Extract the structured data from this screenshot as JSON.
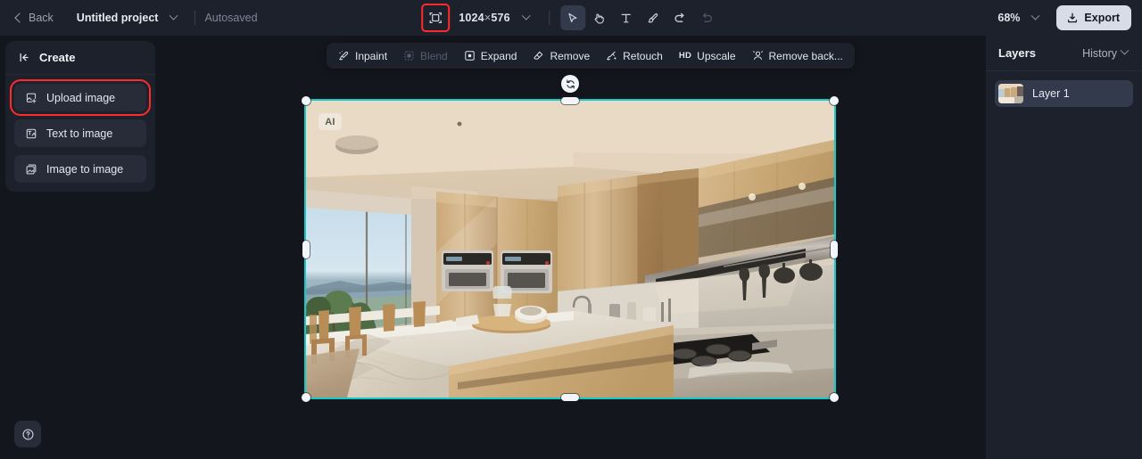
{
  "topbar": {
    "back_label": "Back",
    "project_name": "Untitled project",
    "autosaved_label": "Autosaved",
    "canvas_size_label": "1024 × 576",
    "canvas_width": "1024",
    "canvas_multiply": "×",
    "canvas_height": "576",
    "zoom_level": "68%",
    "export_label": "Export",
    "tools": [
      {
        "name": "crop-resize-icon",
        "label": "Resize canvas",
        "state": "highlighted"
      },
      {
        "name": "select-tool",
        "label": "Select",
        "state": "active"
      },
      {
        "name": "hand-tool",
        "label": "Pan",
        "state": "normal"
      },
      {
        "name": "text-tool",
        "label": "Text",
        "state": "normal"
      },
      {
        "name": "brush-tool",
        "label": "Brush",
        "state": "normal"
      },
      {
        "name": "undo-button",
        "label": "Undo",
        "state": "normal"
      },
      {
        "name": "redo-button",
        "label": "Redo",
        "state": "disabled"
      }
    ]
  },
  "left_panel": {
    "title": "Create",
    "collapse_icon": "collapse-left-icon",
    "items": [
      {
        "label": "Upload image",
        "icon": "upload-image-icon",
        "highlighted": true
      },
      {
        "label": "Text to image",
        "icon": "text-to-image-icon",
        "highlighted": false
      },
      {
        "label": "Image to image",
        "icon": "image-to-image-icon",
        "highlighted": false
      }
    ]
  },
  "edit_toolbar": {
    "items": [
      {
        "label": "Inpaint",
        "icon": "inpaint-icon",
        "disabled": false
      },
      {
        "label": "Blend",
        "icon": "blend-icon",
        "disabled": true
      },
      {
        "label": "Expand",
        "icon": "expand-icon",
        "disabled": false
      },
      {
        "label": "Remove",
        "icon": "remove-icon",
        "disabled": false
      },
      {
        "label": "Retouch",
        "icon": "retouch-icon",
        "disabled": false
      },
      {
        "label": "Upscale",
        "icon": "hd-icon",
        "badge": "HD",
        "disabled": false
      },
      {
        "label": "Remove back...",
        "icon": "remove-background-icon",
        "disabled": false
      }
    ]
  },
  "canvas": {
    "watermark_badge": "AI",
    "selection_color": "#16c9c9",
    "rotate_handle": "rotate-icon"
  },
  "right_panel": {
    "title": "Layers",
    "history_label": "History",
    "layers": [
      {
        "name": "Layer 1"
      }
    ]
  },
  "help": {
    "icon": "help-circle-icon"
  }
}
